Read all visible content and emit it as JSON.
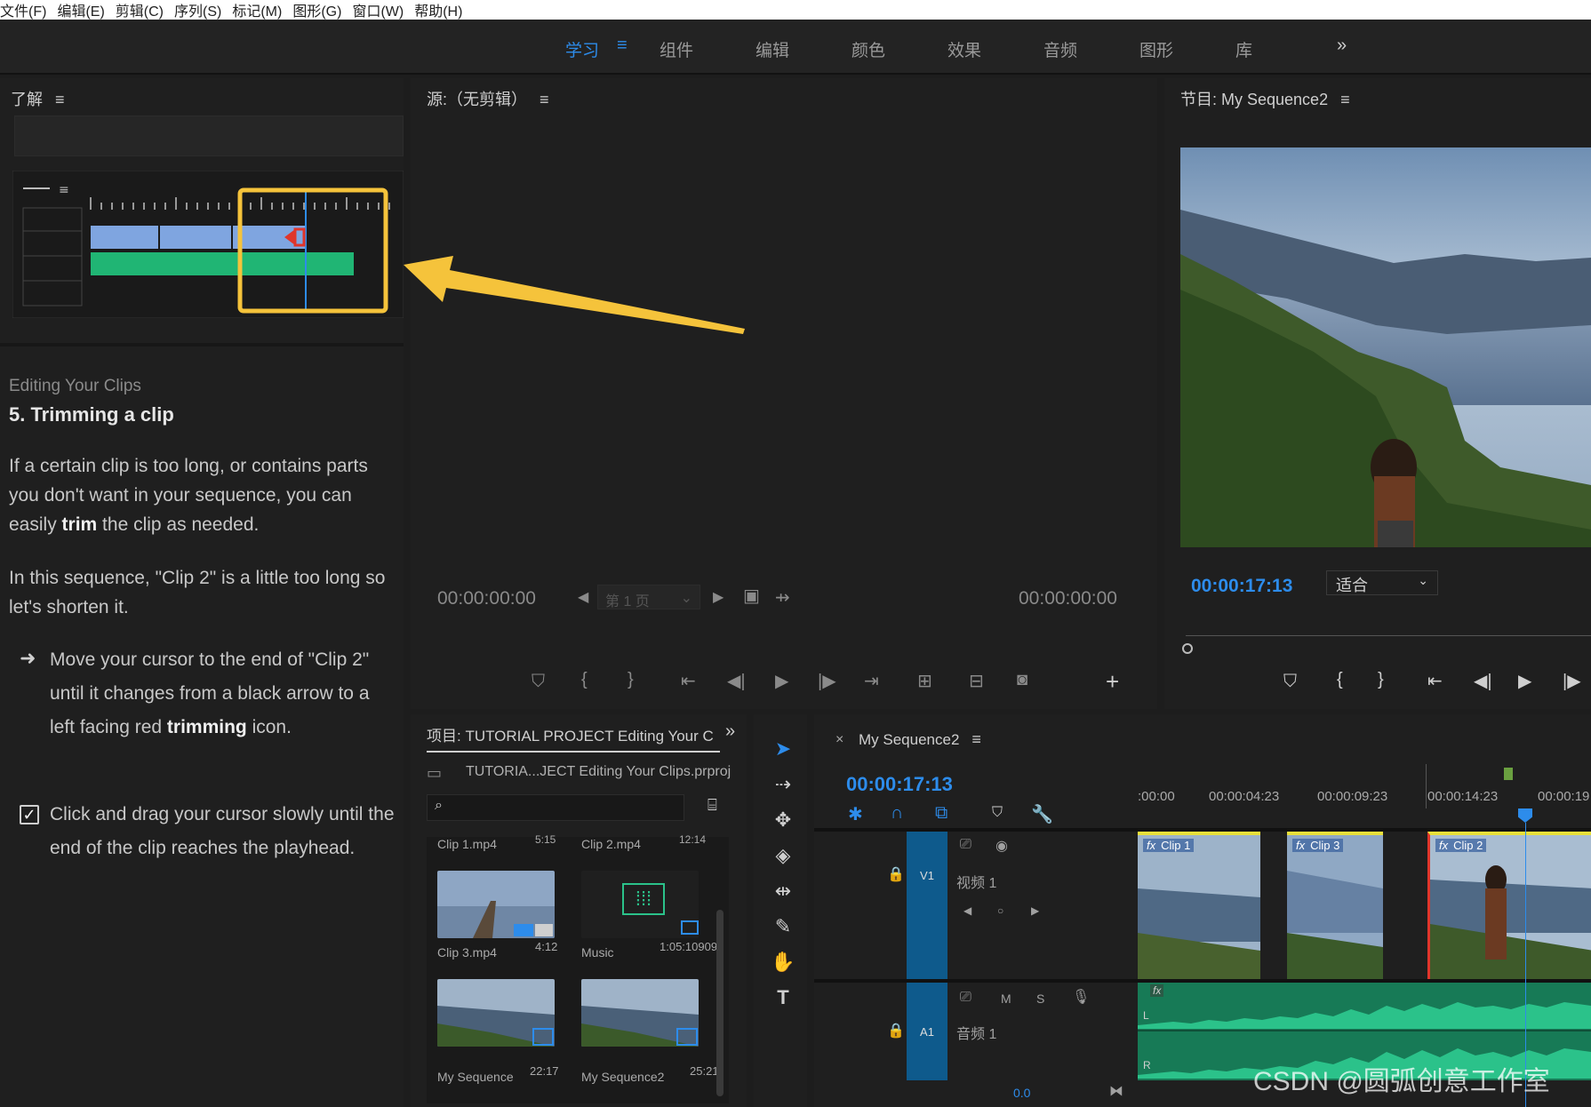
{
  "menu": [
    "文件(F)",
    "编辑(E)",
    "剪辑(C)",
    "序列(S)",
    "标记(M)",
    "图形(G)",
    "窗口(W)",
    "帮助(H)"
  ],
  "workspaces": [
    "学习",
    "组件",
    "编辑",
    "颜色",
    "效果",
    "音频",
    "图形",
    "库"
  ],
  "workspaces_more": "»",
  "learn_panel": {
    "title": "了解",
    "section": "Editing Your Clips",
    "heading": "5. Trimming a clip",
    "p1_a": "If a certain clip is too long, or contains parts you don't want in your sequence, you can easily ",
    "p1_bold": "trim",
    "p1_b": " the clip as needed.",
    "p2": "In this sequence, \"Clip 2\" is a little too long so let's shorten it.",
    "step1_a": "Move your cursor to the end of \"Clip 2\" until it changes from a black arrow to a left facing red ",
    "step1_bold": "trimming",
    "step1_b": " icon.",
    "step2": "Click and drag your cursor slowly until the end of the clip reaches the playhead."
  },
  "source_panel": {
    "title": "源:（无剪辑）",
    "tc_left": "00:00:00:00",
    "tc_right": "00:00:00:00",
    "page": "第 1 页"
  },
  "program_panel": {
    "title": "节目: My Sequence2",
    "timecode": "00:00:17:13",
    "fit": "适合"
  },
  "project_panel": {
    "title": "项目: TUTORIAL PROJECT Editing Your C",
    "file": "TUTORIA...JECT Editing Your Clips.prproj",
    "items": [
      {
        "name": "Clip 1.mp4",
        "dur": "5:15"
      },
      {
        "name": "Clip 2.mp4",
        "dur": "12:14"
      },
      {
        "name": "Clip 3.mp4",
        "dur": "4:12"
      },
      {
        "name": "Music",
        "dur": "1:05:10909"
      },
      {
        "name": "My Sequence",
        "dur": "22:17"
      },
      {
        "name": "My Sequence2",
        "dur": "25:21"
      }
    ]
  },
  "timeline": {
    "tab": "My Sequence2",
    "close": "×",
    "timecode": "00:00:17:13",
    "ruler": [
      ":00:00",
      "00:00:04:23",
      "00:00:09:23",
      "00:00:14:23",
      "00:00:19"
    ],
    "v1": "V1",
    "v1_name": "视频 1",
    "a1": "A1",
    "a1_name": "音频 1",
    "m": "M",
    "s": "S",
    "clips": [
      "Clip 1",
      "Clip 3",
      "Clip 2"
    ],
    "fx": "fx",
    "l": "L",
    "r": "R",
    "vol": "0.0"
  },
  "watermark": "CSDN @圆弧创意工作室",
  "colors": {
    "accent": "#2d8ceb",
    "highlight": "#f5c33b",
    "audio": "#2bc28a"
  }
}
